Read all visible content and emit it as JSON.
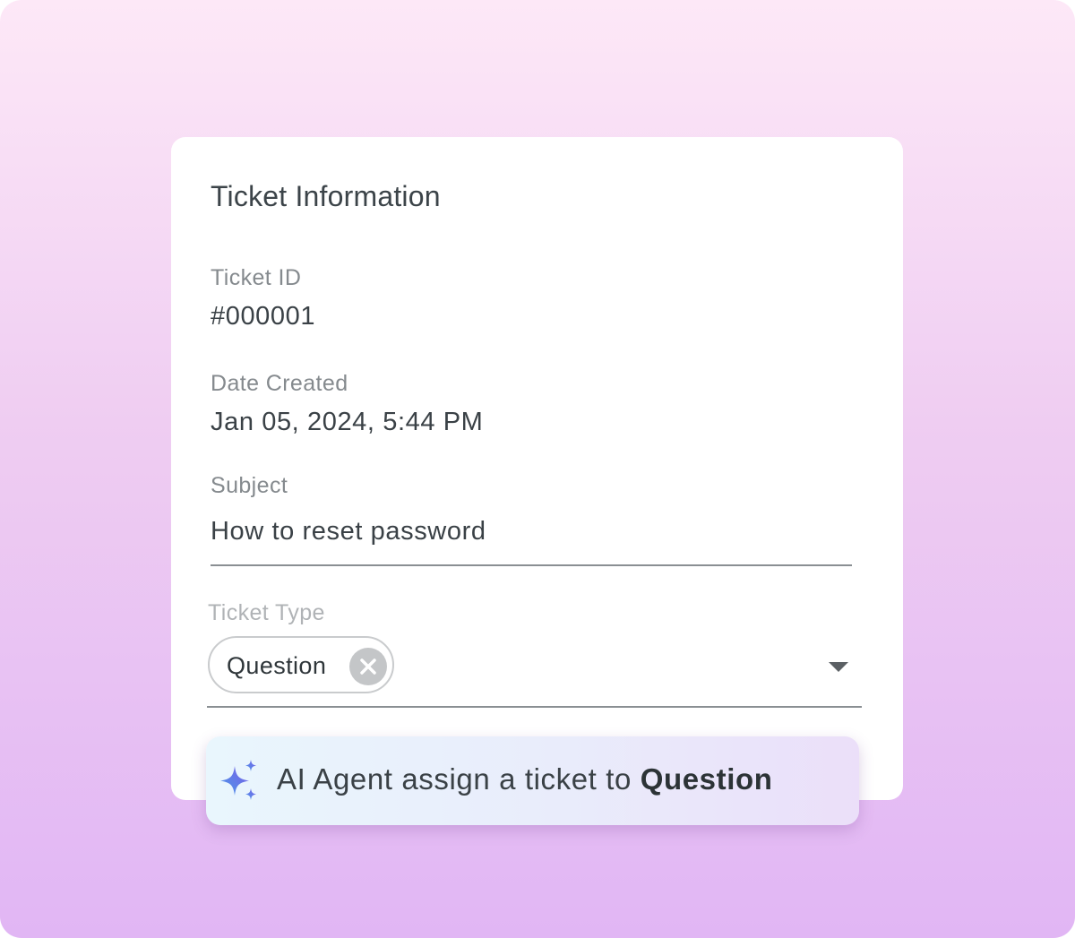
{
  "card": {
    "title": "Ticket Information",
    "fields": [
      {
        "label": "Ticket ID",
        "value": "#000001"
      },
      {
        "label": "Date Created",
        "value": "Jan 05, 2024, 5:44 PM"
      },
      {
        "label": "Subject",
        "value": "How to reset password"
      }
    ],
    "ticket_type": {
      "label": "Ticket Type",
      "selected_chip": "Question",
      "chip_remove_icon": "close-icon",
      "dropdown_icon": "caret-down-icon"
    }
  },
  "ai_banner": {
    "icon": "sparkle-icon",
    "text_prefix": "AI Agent assign a ticket to ",
    "text_highlight": "Question"
  },
  "colors": {
    "background_top": "#fde8f7",
    "background_bottom": "#e1b6f4",
    "sparkle_gradient_start": "#4a9be8",
    "sparkle_gradient_end": "#7b5ce8"
  }
}
